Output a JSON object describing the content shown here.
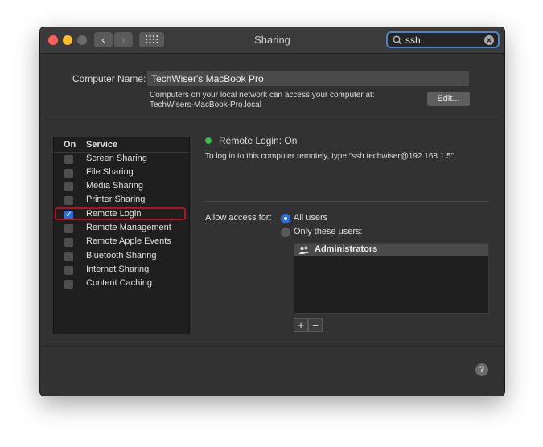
{
  "window": {
    "title": "Sharing"
  },
  "search": {
    "value": "ssh"
  },
  "computer_name": {
    "label": "Computer Name:",
    "value": "TechWiser's MacBook Pro",
    "description_line1": "Computers on your local network can access your computer at:",
    "description_line2": "TechWisers-MacBook-Pro.local",
    "edit_label": "Edit..."
  },
  "services": {
    "header_on": "On",
    "header_service": "Service",
    "items": [
      {
        "label": "Screen Sharing",
        "checked": false
      },
      {
        "label": "File Sharing",
        "checked": false
      },
      {
        "label": "Media Sharing",
        "checked": false
      },
      {
        "label": "Printer Sharing",
        "checked": false
      },
      {
        "label": "Remote Login",
        "checked": true
      },
      {
        "label": "Remote Management",
        "checked": false
      },
      {
        "label": "Remote Apple Events",
        "checked": false
      },
      {
        "label": "Bluetooth Sharing",
        "checked": false
      },
      {
        "label": "Internet Sharing",
        "checked": false
      },
      {
        "label": "Content Caching",
        "checked": false
      }
    ]
  },
  "detail": {
    "status": "Remote Login: On",
    "status_color": "#2fc24a",
    "instructions": "To log in to this computer remotely, type “ssh techwiser@192.168.1.5”.",
    "allow_access_label": "Allow access for:",
    "option_all": "All users",
    "option_only": "Only these users:",
    "selected_option": "All users",
    "users": [
      "Administrators"
    ],
    "add_label": "+",
    "remove_label": "−"
  },
  "help_label": "?",
  "colors": {
    "accent": "#2a6fdc",
    "highlight_border": "#b5121b"
  }
}
